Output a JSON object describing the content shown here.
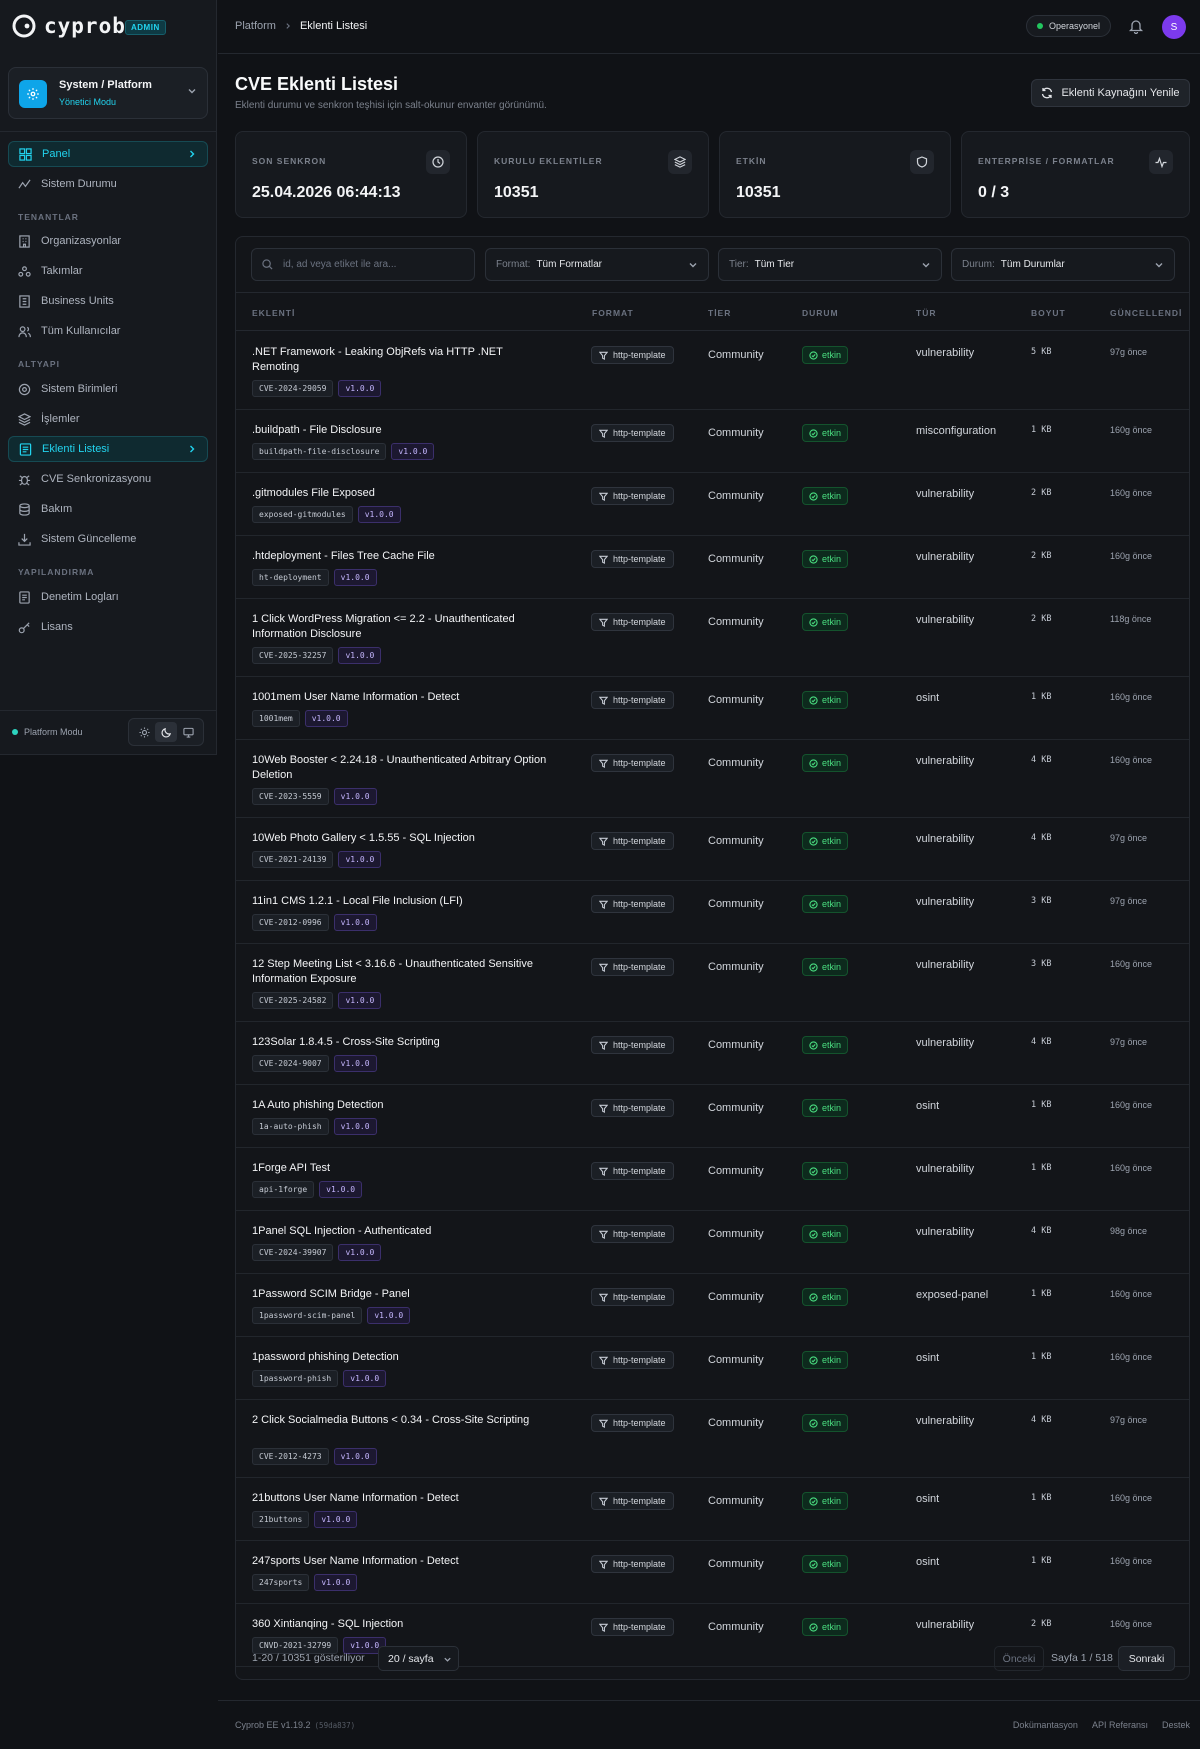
{
  "brand": {
    "name": "cyprob",
    "badge": "ADMIN"
  },
  "context": {
    "title": "System / Platform",
    "subtitle": "Yönetici Modu"
  },
  "nav": {
    "items_top": [
      "Panel",
      "Sistem Durumu"
    ],
    "sec_tenants": "TENANTLAR",
    "tenants": [
      "Organizasyonlar",
      "Takımlar",
      "Business Units",
      "Tüm Kullanıcılar"
    ],
    "sec_infra": "ALTYAPI",
    "infra": [
      "Sistem Birimleri",
      "İşlemler",
      "Eklenti Listesi",
      "CVE Senkronizasyonu",
      "Bakım",
      "Sistem Güncelleme"
    ],
    "sec_config": "YAPILANDIRMA",
    "config": [
      "Denetim Logları",
      "Lisans"
    ]
  },
  "platform_mode": "Platform Modu",
  "breadcrumb": {
    "root": "Platform",
    "current": "Eklenti Listesi"
  },
  "status": "Operasyonel",
  "avatar": "S",
  "page": {
    "title": "CVE Eklenti Listesi",
    "subtitle": "Eklenti durumu ve senkron teşhisi için salt-okunur envanter görünümü.",
    "refresh": "Eklenti Kaynağını Yenile"
  },
  "stats": [
    {
      "label": "SON SENKRON",
      "value": "25.04.2026 06:44:13"
    },
    {
      "label": "KURULU EKLENTİLER",
      "value": "10351"
    },
    {
      "label": "ETKİN",
      "value": "10351"
    },
    {
      "label": "ENTERPRİSE / FORMATLAR",
      "value": "0 / 3"
    }
  ],
  "filters": {
    "search_placeholder": "id, ad veya etiket ile ara...",
    "format_label": "Format:",
    "format_value": "Tüm Formatlar",
    "tier_label": "Tier:",
    "tier_value": "Tüm Tier",
    "status_label": "Durum:",
    "status_value": "Tüm Durumlar"
  },
  "columns": [
    "EKLENTİ",
    "FORMAT",
    "TİER",
    "DURUM",
    "TÜR",
    "BOYUT",
    "GÜNCELLENDİ"
  ],
  "rows": [
    {
      "name": ".NET Framework - Leaking ObjRefs via HTTP .NET Remoting",
      "id": "CVE-2024-29059",
      "ver": "v1.0.0",
      "format": "http-template",
      "tier": "Community",
      "status": "etkin",
      "type": "vulnerability",
      "size": "5 KB",
      "updated": "97g önce"
    },
    {
      "name": ".buildpath - File Disclosure",
      "id": "buildpath-file-disclosure",
      "ver": "v1.0.0",
      "format": "http-template",
      "tier": "Community",
      "status": "etkin",
      "type": "misconfiguration",
      "size": "1 KB",
      "updated": "160g önce"
    },
    {
      "name": ".gitmodules File Exposed",
      "id": "exposed-gitmodules",
      "ver": "v1.0.0",
      "format": "http-template",
      "tier": "Community",
      "status": "etkin",
      "type": "vulnerability",
      "size": "2 KB",
      "updated": "160g önce"
    },
    {
      "name": ".htdeployment - Files Tree Cache File",
      "id": "ht-deployment",
      "ver": "v1.0.0",
      "format": "http-template",
      "tier": "Community",
      "status": "etkin",
      "type": "vulnerability",
      "size": "2 KB",
      "updated": "160g önce"
    },
    {
      "name": "1 Click WordPress Migration <= 2.2 - Unauthenticated Information Disclosure",
      "id": "CVE-2025-32257",
      "ver": "v1.0.0",
      "format": "http-template",
      "tier": "Community",
      "status": "etkin",
      "type": "vulnerability",
      "size": "2 KB",
      "updated": "118g önce"
    },
    {
      "name": "1001mem User Name Information - Detect",
      "id": "1001mem",
      "ver": "v1.0.0",
      "format": "http-template",
      "tier": "Community",
      "status": "etkin",
      "type": "osint",
      "size": "1 KB",
      "updated": "160g önce"
    },
    {
      "name": "10Web Booster < 2.24.18 - Unauthenticated Arbitrary Option Deletion",
      "id": "CVE-2023-5559",
      "ver": "v1.0.0",
      "format": "http-template",
      "tier": "Community",
      "status": "etkin",
      "type": "vulnerability",
      "size": "4 KB",
      "updated": "160g önce"
    },
    {
      "name": "10Web Photo Gallery < 1.5.55 - SQL Injection",
      "id": "CVE-2021-24139",
      "ver": "v1.0.0",
      "format": "http-template",
      "tier": "Community",
      "status": "etkin",
      "type": "vulnerability",
      "size": "4 KB",
      "updated": "97g önce"
    },
    {
      "name": "11in1 CMS 1.2.1 - Local File Inclusion (LFI)",
      "id": "CVE-2012-0996",
      "ver": "v1.0.0",
      "format": "http-template",
      "tier": "Community",
      "status": "etkin",
      "type": "vulnerability",
      "size": "3 KB",
      "updated": "97g önce"
    },
    {
      "name": "12 Step Meeting List < 3.16.6 - Unauthenticated Sensitive Information Exposure",
      "id": "CVE-2025-24582",
      "ver": "v1.0.0",
      "format": "http-template",
      "tier": "Community",
      "status": "etkin",
      "type": "vulnerability",
      "size": "3 KB",
      "updated": "160g önce"
    },
    {
      "name": "123Solar 1.8.4.5 - Cross-Site Scripting",
      "id": "CVE-2024-9007",
      "ver": "v1.0.0",
      "format": "http-template",
      "tier": "Community",
      "status": "etkin",
      "type": "vulnerability",
      "size": "4 KB",
      "updated": "97g önce"
    },
    {
      "name": "1A Auto phishing Detection",
      "id": "1a-auto-phish",
      "ver": "v1.0.0",
      "format": "http-template",
      "tier": "Community",
      "status": "etkin",
      "type": "osint",
      "size": "1 KB",
      "updated": "160g önce"
    },
    {
      "name": "1Forge API Test",
      "id": "api-1forge",
      "ver": "v1.0.0",
      "format": "http-template",
      "tier": "Community",
      "status": "etkin",
      "type": "vulnerability",
      "size": "1 KB",
      "updated": "160g önce"
    },
    {
      "name": "1Panel SQL Injection - Authenticated",
      "id": "CVE-2024-39907",
      "ver": "v1.0.0",
      "format": "http-template",
      "tier": "Community",
      "status": "etkin",
      "type": "vulnerability",
      "size": "4 KB",
      "updated": "98g önce"
    },
    {
      "name": "1Password SCIM Bridge - Panel",
      "id": "1password-scim-panel",
      "ver": "v1.0.0",
      "format": "http-template",
      "tier": "Community",
      "status": "etkin",
      "type": "exposed-panel",
      "size": "1 KB",
      "updated": "160g önce"
    },
    {
      "name": "1password phishing Detection",
      "id": "1password-phish",
      "ver": "v1.0.0",
      "format": "http-template",
      "tier": "Community",
      "status": "etkin",
      "type": "osint",
      "size": "1 KB",
      "updated": "160g önce"
    },
    {
      "name": "2 Click Socialmedia Buttons < 0.34 - Cross-Site Scripting",
      "id": "CVE-2012-4273",
      "ver": "v1.0.0",
      "format": "http-template",
      "tier": "Community",
      "status": "etkin",
      "type": "vulnerability",
      "size": "4 KB",
      "updated": "97g önce"
    },
    {
      "name": "21buttons User Name Information - Detect",
      "id": "21buttons",
      "ver": "v1.0.0",
      "format": "http-template",
      "tier": "Community",
      "status": "etkin",
      "type": "osint",
      "size": "1 KB",
      "updated": "160g önce"
    },
    {
      "name": "247sports User Name Information - Detect",
      "id": "247sports",
      "ver": "v1.0.0",
      "format": "http-template",
      "tier": "Community",
      "status": "etkin",
      "type": "osint",
      "size": "1 KB",
      "updated": "160g önce"
    },
    {
      "name": "360 Xintianqing - SQL Injection",
      "id": "CNVD-2021-32799",
      "ver": "v1.0.0",
      "format": "http-template",
      "tier": "Community",
      "status": "etkin",
      "type": "vulnerability",
      "size": "2 KB",
      "updated": "160g önce"
    }
  ],
  "pagination": {
    "showing": "1-20 / 10351 gösteriliyor",
    "per_page": "20 / sayfa",
    "prev": "Önceki",
    "page": "Sayfa 1 / 518",
    "next": "Sonraki"
  },
  "footer": {
    "version": "Cyprob EE v1.19.2",
    "build": "(59da837)",
    "links": [
      "Dokümantasyon",
      "API Referansı",
      "Destek"
    ]
  }
}
